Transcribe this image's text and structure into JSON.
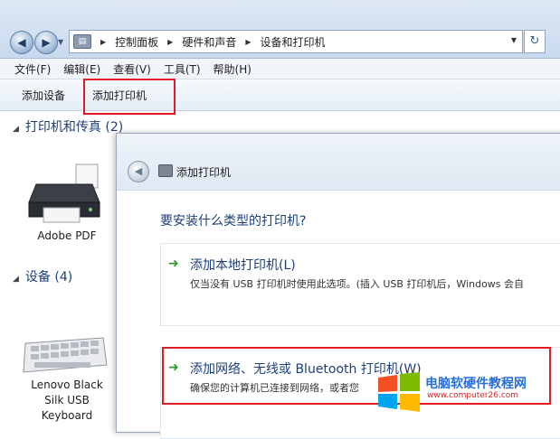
{
  "address_bar": {
    "crumbs": [
      "控制面板",
      "硬件和声音",
      "设备和打印机"
    ]
  },
  "menu": {
    "items": [
      "文件(F)",
      "编辑(E)",
      "查看(V)",
      "工具(T)",
      "帮助(H)"
    ]
  },
  "toolbar": {
    "add_device": "添加设备",
    "add_printer": "添加打印机"
  },
  "groups": {
    "printers_heading": "打印机和传真 (2)",
    "devices_heading": "设备 (4)",
    "printer_device": "Adobe PDF",
    "keyboard_device": [
      "Lenovo Black",
      "Silk USB",
      "Keyboard"
    ]
  },
  "dialog": {
    "title": "添加打印机",
    "question": "要安装什么类型的打印机?",
    "local_option": {
      "title": "添加本地打印机(L)",
      "description": "仅当没有 USB 打印机时使用此选项。(插入 USB 打印机后，Windows 会自"
    },
    "network_option": {
      "title": "添加网络、无线或 Bluetooth 打印机(W)",
      "description": "确保您的计算机已连接到网络，或者您"
    }
  },
  "watermark": {
    "text": "电脑软硬件教程网",
    "url": "www.computer26.com"
  },
  "colors": {
    "highlight_red": "#e01b24",
    "heading_blue": "#1e3f76",
    "arrow_green": "#2e9a2e"
  }
}
